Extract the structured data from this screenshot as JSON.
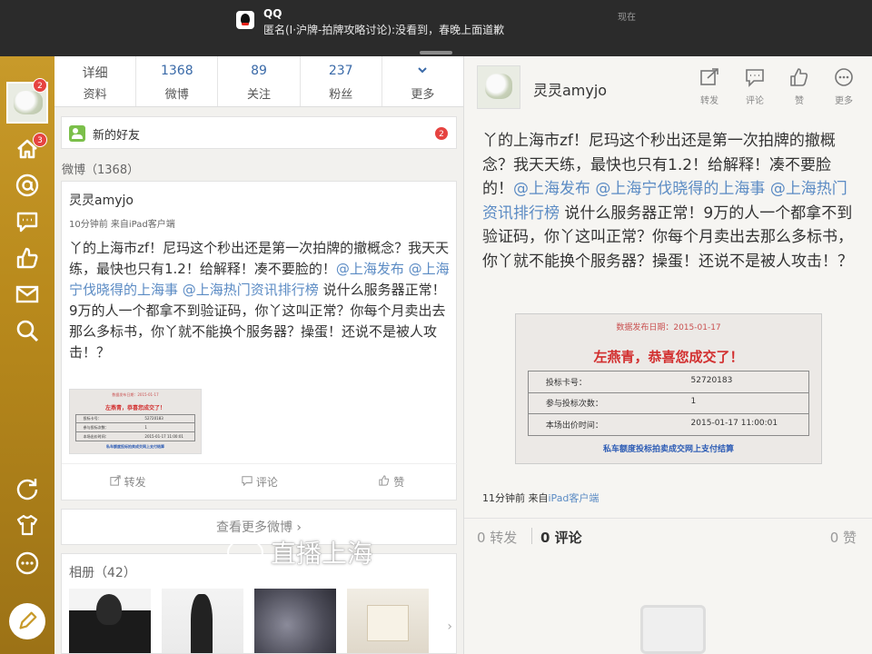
{
  "notification": {
    "app": "QQ",
    "message": "匿名(I·沪牌-拍牌攻略讨论):没看到，春晚上面道歉",
    "time": "现在"
  },
  "sidebar": {
    "avatar_badge": "2",
    "home_badge": "3",
    "icons": [
      "home-icon",
      "at-icon",
      "comment-icon",
      "like-icon",
      "mail-icon",
      "search-icon",
      "refresh-icon",
      "shirt-icon",
      "more-icon",
      "compose-icon"
    ]
  },
  "stats": [
    {
      "number": "",
      "label": "资料",
      "top": "详细"
    },
    {
      "number": "1368",
      "label": "微博"
    },
    {
      "number": "89",
      "label": "关注"
    },
    {
      "number": "237",
      "label": "粉丝"
    },
    {
      "number": "",
      "label": "更多"
    }
  ],
  "new_friends": {
    "label": "新的好友",
    "badge": "2"
  },
  "weibo_count": "微博（1368）",
  "post": {
    "author": "灵灵amyjo",
    "meta": "10分钟前  来自iPad客户端",
    "text_a": "丫的上海市zf！尼玛这个秒出还是第一次拍牌的撤概念？我天天练，最快也只有1.2！给解释！凑不要脸的！",
    "mention1": "@上海发布",
    "mention2": "@上海宁伐晓得的上海事",
    "mention3": "@上海热门资讯排行榜",
    "text_b": "说什么服务器正常！9万的人一个都拿不到验证码，你丫这叫正常？你每个月卖出去那么多标书，你丫就不能换个服务器？操蛋！还说不是被人攻击！？",
    "actions": {
      "repost": "转发",
      "comment": "评论",
      "like": "赞"
    }
  },
  "more_weibo": "查看更多微博",
  "album": {
    "title": "相册（42）"
  },
  "detail": {
    "author": "灵灵amyjo",
    "actions": {
      "repost": "转发",
      "comment": "评论",
      "like": "赞",
      "more": "更多"
    },
    "text_a": "丫的上海市zf！尼玛这个秒出还是第一次拍牌的撤概念？我天天练，最快也只有1.2！给解释！凑不要脸的！",
    "mention1": "@上海发布",
    "mention2": "@上海宁伐晓得的上海事",
    "mention3": "@上海热门资讯排行榜",
    "text_b": "说什么服务器正常！9万的人一个都拿不到验证码，你丫这叫正常？你每个月卖出去那么多标书，你丫就不能换个服务器？操蛋！还说不是被人攻击！？",
    "time": "11分钟前 来自",
    "source": "iPad客户端",
    "repost_count": "0 转发",
    "comment_count": "0 评论",
    "like_count": "0 赞"
  },
  "certificate": {
    "date": "数据发布日期：2015-01-17",
    "congrats": "左燕青，恭喜您成交了！",
    "row1_k": "投标卡号：",
    "row1_v": "52720183",
    "row2_k": "参与投标次数：",
    "row2_v": "1",
    "row3_k": "本场出价时间：",
    "row3_v": "2015-01-17 11:00:01",
    "footer": "私车额度投标拍卖成交网上支付结算"
  },
  "watermark": "直播上海",
  "colors": {
    "accent": "#3a6aa8",
    "mention": "#5b8bc4",
    "badge": "#e64340",
    "sidebar": "#b98a1c"
  }
}
